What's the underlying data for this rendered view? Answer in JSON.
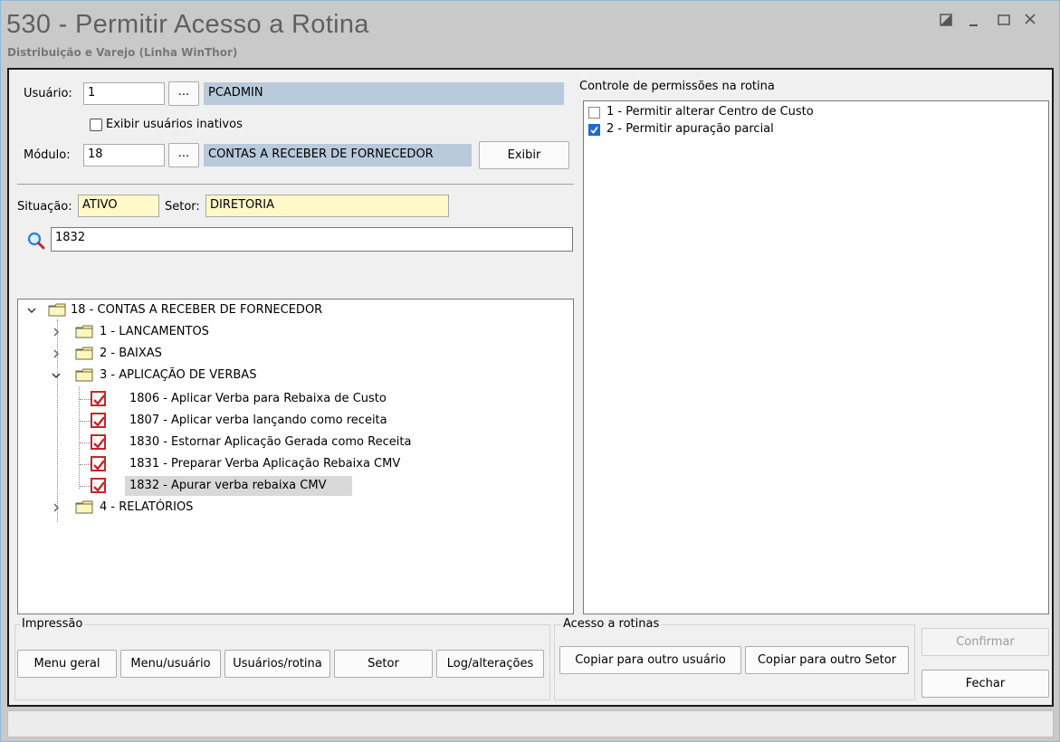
{
  "window": {
    "title": "530 - Permitir Acesso a Rotina",
    "subtitle": "Distribuição e Varejo (Linha WinThor)"
  },
  "user": {
    "label": "Usuário:",
    "code": "1",
    "lookup": "...",
    "name": "PCADMIN",
    "show_inactive_label": "Exibir usuários inativos"
  },
  "module": {
    "label": "Módulo:",
    "code": "18",
    "lookup": "...",
    "name": "CONTAS A RECEBER DE FORNECEDOR",
    "show_button": "Exibir"
  },
  "status": {
    "situacao_label": "Situação:",
    "situacao_value": "ATIVO",
    "setor_label": "Setor:",
    "setor_value": "DIRETORIA"
  },
  "search": {
    "value": "1832"
  },
  "tree": {
    "root": "18 - CONTAS A RECEBER DE FORNECEDOR",
    "groups": [
      {
        "label": "1 - LANCAMENTOS"
      },
      {
        "label": "2 - BAIXAS"
      },
      {
        "label": "3 - APLICAÇÃO DE VERBAS"
      },
      {
        "label": "4 - RELATÓRIOS"
      }
    ],
    "routines": [
      {
        "label": "1806 - Aplicar Verba para Rebaixa de Custo",
        "checked": true
      },
      {
        "label": "1807 - Aplicar verba lançando como receita",
        "checked": true
      },
      {
        "label": "1830 - Estornar Aplicação Gerada como Receita",
        "checked": true
      },
      {
        "label": "1831 - Preparar Verba Aplicação Rebaixa CMV",
        "checked": true
      },
      {
        "label": "1832 - Apurar verba rebaixa CMV",
        "checked": true
      }
    ]
  },
  "permissions": {
    "title": "Controle de permissões na rotina",
    "items": [
      {
        "label": "1 - Permitir alterar Centro de Custo",
        "checked": false
      },
      {
        "label": "2 - Permitir apuração parcial",
        "checked": true
      }
    ]
  },
  "impressao": {
    "title": "Impressão",
    "buttons": [
      "Menu geral",
      "Menu/usuário",
      "Usuários/rotina",
      "Setor",
      "Log/alterações"
    ]
  },
  "acesso": {
    "title": "Acesso a rotinas",
    "buttons": [
      "Copiar para outro usuário",
      "Copiar para outro Setor"
    ]
  },
  "actions": {
    "confirm": "Confirmar",
    "close": "Fechar"
  },
  "colors": {
    "readonly_field": "#b8cadb",
    "highlight_field": "#fff8c8",
    "check_red": "#c3272b",
    "check_blue": "#1c6bd6"
  }
}
